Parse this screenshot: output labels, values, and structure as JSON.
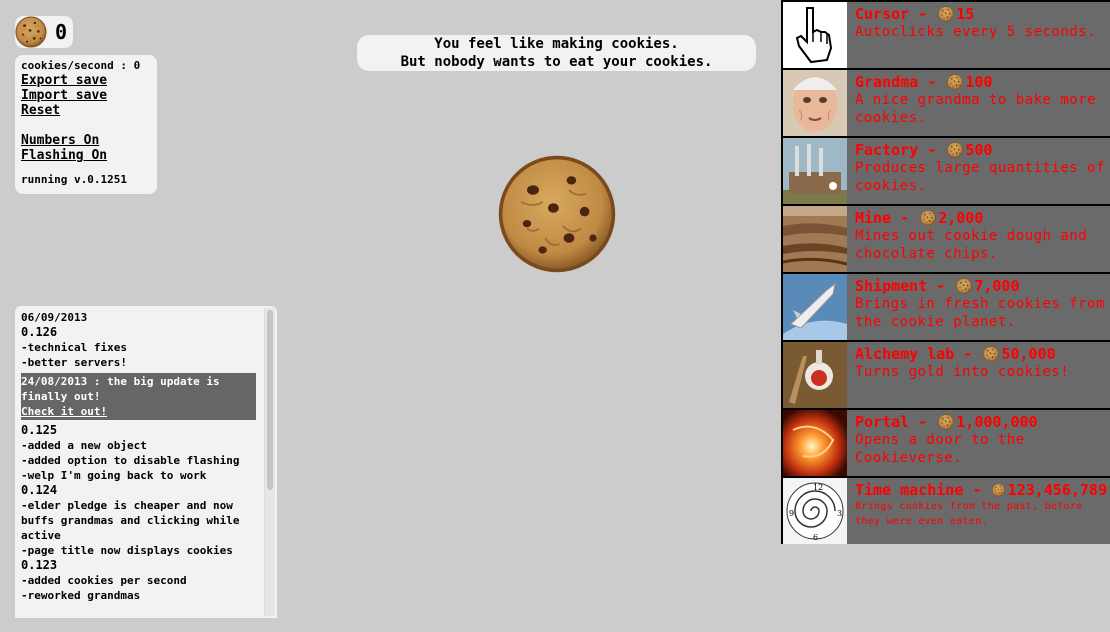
{
  "counter": {
    "cookies": "0"
  },
  "options": {
    "cps": "cookies/second : 0",
    "export_save": "Export save",
    "import_save": "Import save",
    "reset": "Reset",
    "numbers": "Numbers On",
    "flashing": "Flashing On",
    "version": "running v.0.1251"
  },
  "message": {
    "line1": "You feel like making cookies.",
    "line2": "But nobody wants to eat your cookies."
  },
  "news": {
    "top": [
      {
        "text": "06/09/2013",
        "kind": "d"
      },
      {
        "text": "0.126",
        "kind": "v"
      },
      {
        "text": "-technical fixes",
        "kind": "i"
      },
      {
        "text": "-better servers!",
        "kind": "i"
      }
    ],
    "highlight": {
      "text": "24/08/2013 : the big update is finally out!",
      "link": "Check it out!"
    },
    "rest": [
      {
        "text": "0.125",
        "kind": "v"
      },
      {
        "text": "-added a new object",
        "kind": "i"
      },
      {
        "text": "-added option to disable flashing",
        "kind": "i"
      },
      {
        "text": "-welp I'm going back to work",
        "kind": "i"
      },
      {
        "text": "0.124",
        "kind": "v"
      },
      {
        "text": "-elder pledge is cheaper and now buffs grandmas and clicking while active",
        "kind": "i"
      },
      {
        "text": "-page title now displays cookies",
        "kind": "i"
      },
      {
        "text": "0.123",
        "kind": "v"
      },
      {
        "text": "-added cookies per second",
        "kind": "i"
      },
      {
        "text": "-reworked grandmas",
        "kind": "i"
      }
    ]
  },
  "store": {
    "items": [
      {
        "name": "Cursor",
        "price": "15",
        "desc": "Autoclicks every 5 seconds.",
        "icon": "cursor-icon",
        "small": false
      },
      {
        "name": "Grandma",
        "price": "100",
        "desc": "A nice grandma to bake more cookies.",
        "icon": "grandma-icon",
        "small": false
      },
      {
        "name": "Factory",
        "price": "500",
        "desc": "Produces large quantities of cookies.",
        "icon": "factory-icon",
        "small": false
      },
      {
        "name": "Mine",
        "price": "2,000",
        "desc": "Mines out cookie dough and chocolate chips.",
        "icon": "mine-icon",
        "small": false
      },
      {
        "name": "Shipment",
        "price": "7,000",
        "desc": "Brings in fresh cookies from the cookie planet.",
        "icon": "shipment-icon",
        "small": false
      },
      {
        "name": "Alchemy lab",
        "price": "50,000",
        "desc": "Turns gold into cookies!",
        "icon": "alchemy-lab-icon",
        "small": false
      },
      {
        "name": "Portal",
        "price": "1,000,000",
        "desc": "Opens a door to the Cookieverse.",
        "icon": "portal-icon",
        "small": false
      },
      {
        "name": "Time machine",
        "price": "123,456,789",
        "desc": "Brings cookies from the past, before they were even eaten.",
        "icon": "time-machine-icon",
        "small": true
      }
    ]
  },
  "colors": {
    "price_text": "#ff0000",
    "store_bg": "#6a6a6a",
    "page_bg": "#cccccc"
  }
}
